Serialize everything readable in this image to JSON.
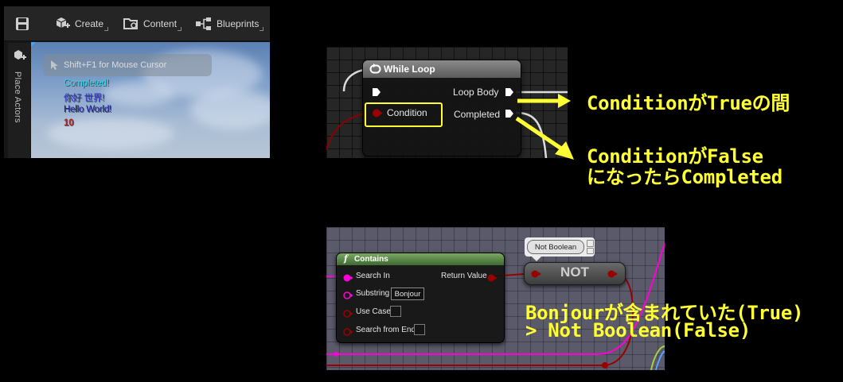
{
  "toolbar": {
    "create_label": "Create",
    "content_label": "Content",
    "blueprints_label": "Blueprints"
  },
  "sidebar": {
    "label": "Place Actors"
  },
  "viewport": {
    "hint": "Shift+F1 for Mouse Cursor",
    "log": [
      {
        "text": "Completed!",
        "color": "#2fd8e8"
      },
      {
        "text": "你好 世界!",
        "color": "#3535c8"
      },
      {
        "text": "Hello World!",
        "color": "#2020a8"
      },
      {
        "text": "10",
        "color": "#c81818"
      }
    ]
  },
  "while_loop": {
    "title": "While Loop",
    "condition_label": "Condition",
    "loop_body_label": "Loop Body",
    "completed_label": "Completed"
  },
  "annotations": {
    "while_true": "ConditionがTrueの間",
    "while_false_1": "ConditionがFalse",
    "while_false_2": "になったらCompleted",
    "contains_1": "Bonjourが含まれていた(True)",
    "contains_2": "> Not Boolean(False)"
  },
  "contains_node": {
    "title": "Contains",
    "search_in_label": "Search In",
    "substring_label": "Substring",
    "substring_value": "Bonjour",
    "use_case_label": "Use Case",
    "search_from_end_label": "Search from End",
    "return_value_label": "Return Value"
  },
  "not_node": {
    "tooltip": "Not Boolean",
    "label": "NOT"
  },
  "colors": {
    "annotation": "#ffff33",
    "exec_pin": "#ffffff",
    "bool_pin": "#9b0000",
    "string_pin": "#ff00d8",
    "function_header": "#5e8c4a"
  }
}
